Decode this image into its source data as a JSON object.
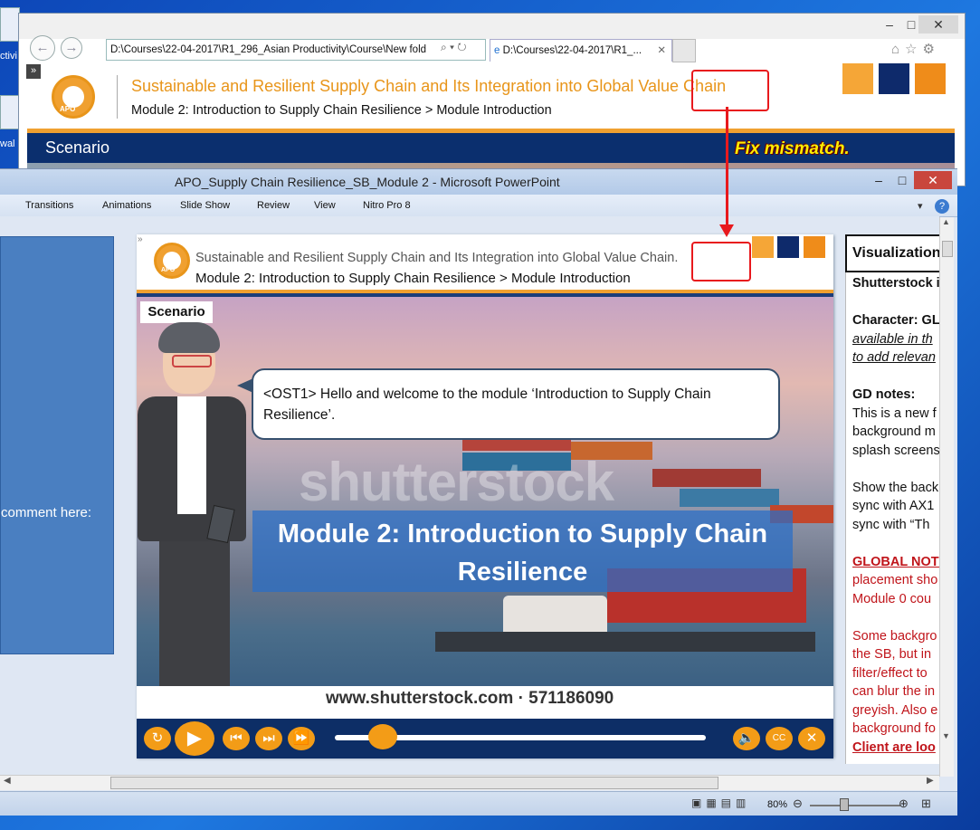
{
  "desktop": {
    "icon1_label": "ctivi",
    "icon2_label": "wal"
  },
  "ie": {
    "address": "D:\\Courses\\22-04-2017\\R1_296_Asian Productivity\\Course\\New fold",
    "tab_label": "D:\\Courses\\22-04-2017\\R1_...",
    "expand_glyph": "»",
    "header_title": "Sustainable and Resilient Supply Chain and Its Integration into Global Value Chain",
    "header_sub": "Module 2: Introduction to Supply Chain Resilience > Module Introduction",
    "bar_label": "Scenario",
    "logo_text": "APO"
  },
  "annotation": {
    "text": "Fix mismatch."
  },
  "ppt": {
    "title": "APO_Supply Chain Resilience_SB_Module 2  -  Microsoft PowerPoint",
    "ribbon_tabs": [
      "Transitions",
      "Animations",
      "Slide Show",
      "Review",
      "View",
      "Nitro Pro 8"
    ],
    "comment_text": "comment here:",
    "zoom": "80%"
  },
  "slide": {
    "header_title": "Sustainable and Resilient Supply Chain and Its Integration into Global Value Chain.",
    "header_sub": "Module 2: Introduction to Supply Chain Resilience > Module  Introduction",
    "scenario_label": "Scenario",
    "bubble_text": "<OST1> Hello and welcome to the module ‘Introduction to Supply Chain Resilience’.",
    "watermark": "shutterstock",
    "module_title": "Module 2: Introduction to Supply Chain Resilience",
    "stock_url": "www.shutterstock.com · 571186090",
    "logo_text": "APO"
  },
  "notes": {
    "header": "Visualization",
    "lines": [
      {
        "text": "Shutterstock i",
        "color": "#111",
        "bold": true
      },
      {
        "text": "",
        "color": "#111"
      },
      {
        "text": "Character: GL",
        "color": "#111",
        "bold": true
      },
      {
        "text": "available in th",
        "color": "#111",
        "italic": true
      },
      {
        "text": "to add relevan",
        "color": "#111",
        "italic": true
      },
      {
        "text": "",
        "color": "#111"
      },
      {
        "text": "GD notes:",
        "color": "#111",
        "bold": true
      },
      {
        "text": "This is a new f",
        "color": "#111"
      },
      {
        "text": "background m",
        "color": "#111"
      },
      {
        "text": "splash screens",
        "color": "#111"
      },
      {
        "text": "",
        "color": "#111"
      },
      {
        "text": "Show the back",
        "color": "#111"
      },
      {
        "text": "sync with AX1",
        "color": "#111"
      },
      {
        "text": "sync with “Th",
        "color": "#111"
      },
      {
        "text": "",
        "color": "#111"
      },
      {
        "text": "GLOBAL NOTE",
        "color": "#c0141a",
        "bold": true
      },
      {
        "text": "placement sho",
        "color": "#c0141a"
      },
      {
        "text": "Module 0 cou",
        "color": "#c0141a"
      },
      {
        "text": "",
        "color": "#c0141a"
      },
      {
        "text": "Some backgro",
        "color": "#c0141a"
      },
      {
        "text": "the SB, but in",
        "color": "#c0141a"
      },
      {
        "text": "filter/effect to",
        "color": "#c0141a"
      },
      {
        "text": "can blur the in",
        "color": "#c0141a"
      },
      {
        "text": "greyish. Also e",
        "color": "#c0141a"
      },
      {
        "text": "background fo",
        "color": "#c0141a"
      },
      {
        "text": "Client are loo",
        "color": "#c0141a",
        "bold": true
      }
    ]
  },
  "colors": {
    "accent_orange": "#f0a030",
    "navy": "#0b2f6e",
    "annotation_red": "#e8191d",
    "annotation_yellow": "#ffee00"
  }
}
